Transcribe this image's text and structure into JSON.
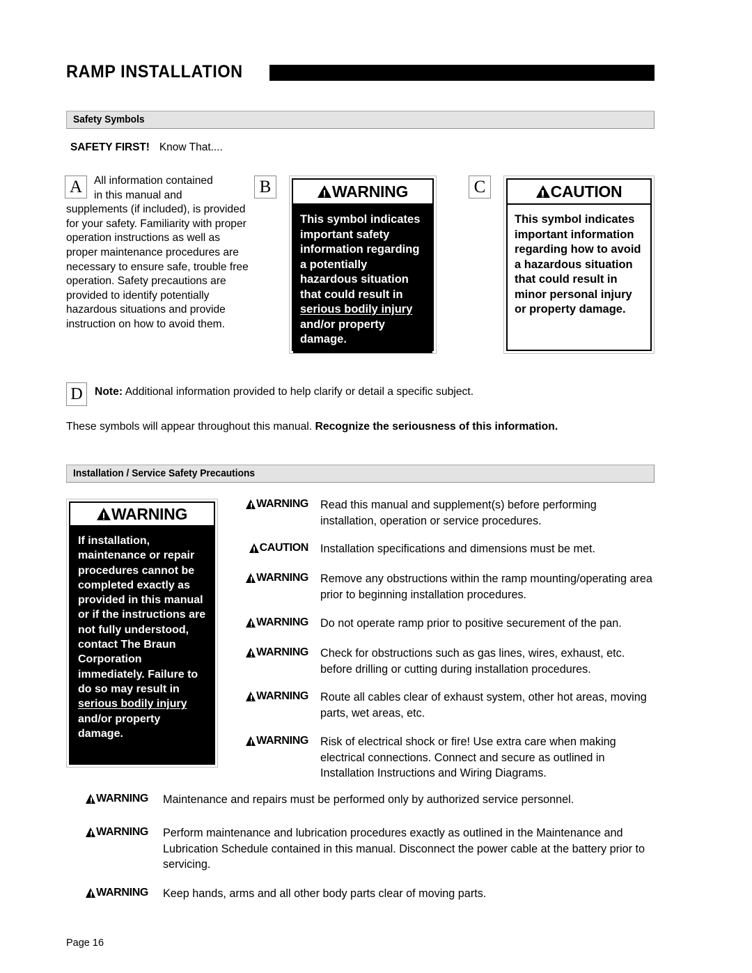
{
  "document": {
    "title": "RAMP INSTALLATION",
    "footer": "Page 16"
  },
  "sections": {
    "safety_symbols": {
      "heading": "Safety Symbols",
      "safety_first_bold": "SAFETY FIRST!",
      "safety_first_rest": "Know That....",
      "symbols_note_normal": "These symbols will appear throughout this manual.",
      "symbols_note_bold": "Recognize the seriousness of this information."
    },
    "install_service": {
      "heading": "Installation / Service Safety Precautions"
    }
  },
  "callouts": {
    "a": {
      "letter": "A",
      "line1": "All information contained",
      "line2": "in this manual and",
      "rest": "supplements (if included), is provided for your safety.  Familiarity with proper operation instructions as well as proper maintenance procedures are necessary to ensure safe, trouble free operation. Safety precautions are provided to identify potentially hazardous situations and provide instruction on how to avoid them."
    },
    "b": {
      "letter": "B",
      "signal_word": "WARNING",
      "text_before": "This symbol indicates important safety information regarding a potentially hazardous situation that could result  in ",
      "text_underlined": "serious bodily injury",
      "text_after": " and/or property damage."
    },
    "c": {
      "letter": "C",
      "signal_word": "CAUTION",
      "text": "This symbol indicates important  information regarding how to avoid a hazardous situation that could result in minor personal injury or property damage."
    },
    "d": {
      "letter": "D",
      "bold": "Note:",
      "text": "Additional information provided to help clarify or detail a specific subject."
    }
  },
  "big_warning": {
    "signal_word": "WARNING",
    "text_before": "If installation, maintenance or repair procedures cannot be completed exactly as provided in this manual or if the instructions are not fully understood, contact The Braun Corporation immediately.  Failure to do so may result  in ",
    "text_underlined": "serious bodily injury",
    "text_after": " and/or property damage."
  },
  "precaution_rows": [
    {
      "id": "read",
      "signal_word": "WARNING",
      "text": "Read this manual and supplement(s) before performing installation, operation or service procedures."
    },
    {
      "id": "specs",
      "signal_word": "CAUTION",
      "text": "Installation specifications and dimensions must be met."
    },
    {
      "id": "obstruct",
      "signal_word": "WARNING",
      "text": "Remove any obstructions within the ramp mounting/operating area prior to beginning installation procedures."
    },
    {
      "id": "operate",
      "signal_word": "WARNING",
      "text": "Do not operate ramp prior to positive securement of the pan."
    },
    {
      "id": "check",
      "signal_word": "WARNING",
      "text": "Check for obstructions such as gas lines, wires, exhaust, etc. before drilling or cutting during installation procedures."
    },
    {
      "id": "route",
      "signal_word": "WARNING",
      "text": "Route all cables clear of exhaust system, other hot areas, moving parts, wet areas, etc."
    },
    {
      "id": "electrical",
      "signal_word": "WARNING",
      "text": "Risk of electrical shock or fire!  Use extra care when making electrical connections.  Connect and secure as outlined in Installation Instructions and Wiring Diagrams."
    },
    {
      "id": "maintenance",
      "signal_word": "WARNING",
      "text": "Maintenance and repairs must be performed only by authorized service personnel."
    },
    {
      "id": "lubrication",
      "signal_word": "WARNING",
      "text": "Perform maintenance and lubrication procedures exactly as outlined in the Maintenance and Lubrication Schedule contained in this manual.  Disconnect the power cable at the battery prior to servicing."
    },
    {
      "id": "hands",
      "signal_word": "WARNING",
      "text": "Keep hands, arms and all other body parts clear of moving parts."
    }
  ],
  "colors": {
    "signal_box_fill": "#000000",
    "section_bar_fill": "#e3e3e3",
    "text": "#000000"
  }
}
